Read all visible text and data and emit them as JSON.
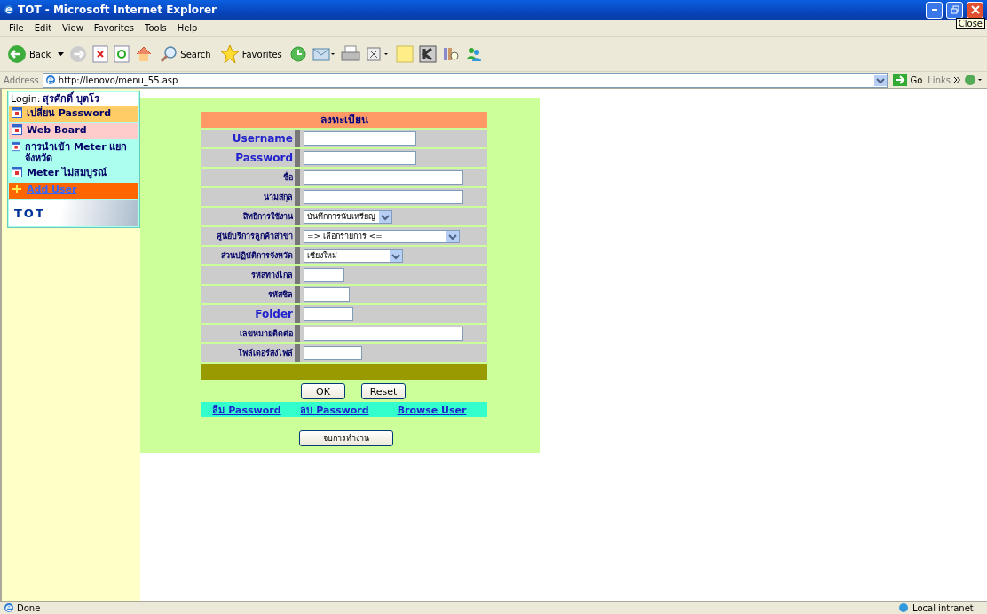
{
  "window": {
    "title": "TOT - Microsoft Internet Explorer",
    "tooltip": "Close"
  },
  "menu": [
    "File",
    "Edit",
    "View",
    "Favorites",
    "Tools",
    "Help"
  ],
  "toolbar": {
    "back": "Back",
    "search": "Search",
    "favorites": "Favorites"
  },
  "address": {
    "label": "Address",
    "url": "http://lenovo/menu_55.asp",
    "go": "Go",
    "links": "Links"
  },
  "sidebar": {
    "login_label": "Login:",
    "login_name": "สุรศักดิ์ บุตโร",
    "items": [
      {
        "label": "เปลี่ยน Password",
        "color": "#ffcc66",
        "kind": "item"
      },
      {
        "label": "Web Board",
        "color": "#ffcccc",
        "kind": "item"
      },
      {
        "label": "การนำเข้า Meter แยกจังหวัด",
        "color": "#aaffee",
        "kind": "item"
      },
      {
        "label": "Meter ไม่สมบูรณ์",
        "color": "#aaffee",
        "kind": "item"
      },
      {
        "label": "Add User",
        "color": "#ff6600",
        "kind": "link"
      }
    ],
    "logo": "TOT"
  },
  "form": {
    "title": "ลงทะเบียน",
    "fields": [
      {
        "label": "Username",
        "kind": "text",
        "latin": true
      },
      {
        "label": "Password",
        "kind": "text",
        "latin": true
      },
      {
        "label": "ชื่อ",
        "kind": "text",
        "latin": false
      },
      {
        "label": "นามสกุล",
        "kind": "text",
        "latin": false
      },
      {
        "label": "สิทธิการใช้งาน",
        "kind": "select",
        "value": "บันทึกการนับเหรียญ",
        "latin": false
      },
      {
        "label": "ศูนย์บริการลูกค้าสาขา",
        "kind": "select",
        "value": "=> เลือกรายการ <=",
        "latin": false
      },
      {
        "label": "ส่วนปฏิบัติการจังหวัด",
        "kind": "select",
        "value": "เชียงใหม่",
        "latin": false
      },
      {
        "label": "รหัสทางไกล",
        "kind": "text",
        "latin": false
      },
      {
        "label": "รหัสชิล",
        "kind": "text",
        "latin": false
      },
      {
        "label": "Folder",
        "kind": "text",
        "latin": true
      },
      {
        "label": "เลขหมายติดต่อ",
        "kind": "text",
        "latin": false
      },
      {
        "label": "โฟล์เดอร์ส่งไฟล์",
        "kind": "text",
        "latin": false
      }
    ],
    "buttons": [
      "OK",
      "Reset"
    ],
    "links": [
      "ลืม Password",
      "ลบ Password",
      "Browse User"
    ],
    "end_button": "จบการทำงาน"
  },
  "status_bar": {
    "left": "Done",
    "right": "Local intranet"
  }
}
